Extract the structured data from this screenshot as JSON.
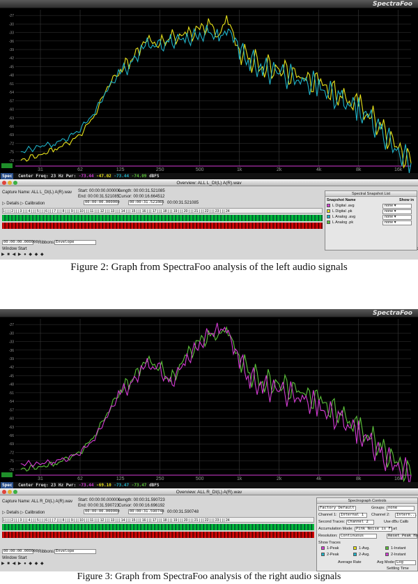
{
  "app_brand": "SpectraFoo",
  "colors": {
    "plot_bg": "#000000",
    "grid": "#3a3a3a",
    "yellow": "#e8e31a",
    "cyan": "#1fb3c8",
    "green": "#5cc23a",
    "magenta": "#d43cd4",
    "dbfs_label": "#9a9a9a"
  },
  "x_tick_labels": [
    "31",
    "62",
    "125",
    "250",
    "500",
    "1k",
    "2k",
    "4k",
    "8k",
    "16k"
  ],
  "y_tick_labels": [
    "-27",
    "-30",
    "-33",
    "-36",
    "-39",
    "-42",
    "-45",
    "-48",
    "-51",
    "-54",
    "-57",
    "-60",
    "-63",
    "-66",
    "-69",
    "-72",
    "-75",
    "-78"
  ],
  "figures": [
    {
      "status": {
        "badge": "Spec",
        "center_freq": "Center Freq: 23 Hz",
        "pwr_label": "Pwr:",
        "v1": "-73.44",
        "v2": "-47.02",
        "v3": "-73.44",
        "v4": "-74.09",
        "unit": "dBFS"
      },
      "overview": {
        "title": "Overview: ALL L_DI(L) A(R).wav",
        "capture_name": "Capture Name: ALL L_DI(L) A(R).wav",
        "start": "Start: 00:00:00.000000",
        "length": "Length: 00:00:31.521085",
        "end": "End: 00:00:31.521085",
        "cursor": "Cursor: 00:00:16.664512",
        "sel_a": "00:00:00.000000",
        "sel_b": "00:00:31.521085",
        "sel_c": "00:00:31.521085",
        "details": "▷ Details ▷ Calibration",
        "ruler": "1 | | | 2 | | | 3 | | | 4 | | | 5 | | | 6 | | | 7 | | | 8 | | | 9 | | | 10 | | | 11 | | | 12 | | | 13 | | | 14 | | | 15 | | | 16 | | | 17 | | | 18 | | | 19 | | | 20 | | | 21 | | | 22 | | | 23 | | | 24",
        "time_field": "00:00:00.000000",
        "ribbons": "Ribbons:",
        "ribbons_value": "Envelope",
        "window_start": "Window Start",
        "window_end": "Window End"
      },
      "panel": {
        "title": "Spectral Snapshot List",
        "col1": "Snapshot Name",
        "col2": "Show in",
        "items": [
          {
            "name": "L Digital .avg",
            "color": "#d43cd4",
            "show": "none"
          },
          {
            "name": "L Digital .pk",
            "color": "#e8e31a",
            "show": "none"
          },
          {
            "name": "L Analog .avg",
            "color": "#1fb3c8",
            "show": "none"
          },
          {
            "name": "L Analog .pk",
            "color": "#5cc23a",
            "show": "none"
          }
        ]
      },
      "caption": "Figure 2: Graph from SpectraFoo analysis of the left audio signals"
    },
    {
      "status": {
        "badge": "Spec",
        "center_freq": "Center Freq: 23 Hz",
        "pwr_label": "Pwr:",
        "v1": "-73.44",
        "v2": "-69.10",
        "v3": "-73.47",
        "v4": "-73.47",
        "unit": "dBFS"
      },
      "overview": {
        "title": "Overview: ALL R_DI(L) A(R).wav",
        "capture_name": "Capture Name: ALL R_DI(L) A(R).wav",
        "start": "Start: 00:00:00.000000",
        "length": "Length: 00:00:31.590723",
        "end": "End: 00:00:31.590723",
        "cursor": "Cursor: 00:00:16.696192",
        "sel_a": "00:00:00.000000",
        "sel_b": "00:00:31.590748",
        "sel_c": "00:00:31.590748",
        "details": "▷ Details ▷ Calibration",
        "ruler": "1 | | | 2 | | | 3 | | | 4 | | | 5 | | | 6 | | | 7 | | | 8 | | | 9 | | | 10 | | | 11 | | | 12 | | | 13 | | | 14 | | | 15 | | | 16 | | | 17 | | | 18 | | | 19 | | | 20 | | | 21 | | | 22 | | | 23 | | | 24",
        "time_field": "00:00:00.000000",
        "ribbons": "Ribbons:",
        "ribbons_value": "Envelope",
        "window_start": "Window Start",
        "window_end": ""
      },
      "panel": {
        "title": "Spectrograph Controls",
        "preset": "Factory Default",
        "groups_label": "Groups:",
        "groups": "none",
        "ch1_label": "Channel 1:",
        "ch1": "Internal 1",
        "ch2_label": "Channel 2:",
        "ch2": "Intern...",
        "second_label": "Second Traces:",
        "second": "Channel 2",
        "use_cal": "Use dBu Calib",
        "accum_label": "Accumulation Mode:",
        "accum": "Pink Noise is Flat",
        "res_label": "Resolution:",
        "res": "Continuous",
        "reset": "Reset Peak Holds",
        "show_traces": "Show Traces",
        "traces": [
          "1-Peak",
          "1-Avg.",
          "1-Instant",
          "2-Peak",
          "2-Avg.",
          "2-Instant"
        ],
        "avg_rate": "Average Rate",
        "avg_mode_label": "Avg Mode:",
        "avg_mode": "Log",
        "settling": "Settling Time"
      },
      "caption": "Figure 3: Graph from SpectraFoo analysis of the right audio signals"
    }
  ],
  "chart_data": [
    {
      "type": "line",
      "title": "",
      "xlabel": "",
      "ylabel": "",
      "x_scale": "log",
      "x_tick_labels": [
        "31",
        "62",
        "125",
        "250",
        "500",
        "1k",
        "2k",
        "4k",
        "8k",
        "16k"
      ],
      "ylim": [
        -80,
        -25
      ],
      "grid": true,
      "series": [
        {
          "color": "#e8e31a",
          "x": [
            22,
            31,
            40,
            50,
            62,
            80,
            100,
            125,
            150,
            180,
            200,
            250,
            300,
            400,
            500,
            600,
            700,
            800,
            900,
            1000,
            1200,
            1500,
            2000,
            3000,
            4000,
            6000,
            8000,
            10000,
            12000,
            16000,
            20000
          ],
          "y": [
            -78,
            -76,
            -74,
            -72,
            -69,
            -62,
            -52,
            -46,
            -43,
            -38,
            -36,
            -37,
            -35,
            -34,
            -32,
            -30,
            -34,
            -27,
            -33,
            -39,
            -42,
            -45,
            -46,
            -49,
            -51,
            -56,
            -59,
            -63,
            -67,
            -74,
            -79
          ]
        },
        {
          "color": "#1fb3c8",
          "x": [
            22,
            31,
            40,
            50,
            62,
            80,
            100,
            125,
            150,
            180,
            200,
            250,
            300,
            400,
            500,
            600,
            700,
            800,
            900,
            1000,
            1200,
            1500,
            2000,
            3000,
            4000,
            6000,
            8000,
            10000,
            12000,
            16000,
            20000
          ],
          "y": [
            -75,
            -73,
            -72,
            -70,
            -67,
            -61,
            -53,
            -47,
            -44,
            -39,
            -37,
            -38,
            -36,
            -35,
            -34,
            -33,
            -35,
            -32,
            -34,
            -40,
            -43,
            -46,
            -47,
            -50,
            -52,
            -57,
            -60,
            -64,
            -68,
            -75,
            -79
          ]
        }
      ]
    },
    {
      "type": "line",
      "title": "",
      "xlabel": "",
      "ylabel": "",
      "x_scale": "log",
      "x_tick_labels": [
        "31",
        "62",
        "125",
        "250",
        "500",
        "1k",
        "2k",
        "4k",
        "8k",
        "16k"
      ],
      "ylim": [
        -80,
        -25
      ],
      "grid": true,
      "series": [
        {
          "color": "#5cc23a",
          "x": [
            22,
            31,
            40,
            50,
            62,
            80,
            100,
            125,
            150,
            180,
            200,
            250,
            300,
            400,
            500,
            600,
            700,
            800,
            900,
            1000,
            1200,
            1500,
            2000,
            3000,
            4000,
            6000,
            8000,
            10000,
            12000,
            16000,
            20000
          ],
          "y": [
            -78,
            -77,
            -76,
            -74,
            -72,
            -66,
            -58,
            -50,
            -47,
            -42,
            -40,
            -42,
            -47,
            -38,
            -33,
            -31,
            -30,
            -28,
            -33,
            -38,
            -44,
            -47,
            -48,
            -51,
            -54,
            -59,
            -64,
            -67,
            -71,
            -76,
            -80
          ]
        },
        {
          "color": "#d43cd4",
          "x": [
            22,
            31,
            40,
            50,
            62,
            80,
            100,
            125,
            150,
            180,
            200,
            250,
            300,
            400,
            500,
            600,
            700,
            800,
            900,
            1000,
            1200,
            1500,
            2000,
            3000,
            4000,
            6000,
            8000,
            10000,
            12000,
            16000,
            20000
          ],
          "y": [
            -76,
            -76,
            -75,
            -74,
            -72,
            -67,
            -59,
            -51,
            -48,
            -43,
            -41,
            -43,
            -48,
            -39,
            -34,
            -30,
            -29,
            -28,
            -35,
            -40,
            -46,
            -49,
            -50,
            -53,
            -56,
            -61,
            -65,
            -69,
            -73,
            -77,
            -80
          ]
        }
      ]
    }
  ]
}
